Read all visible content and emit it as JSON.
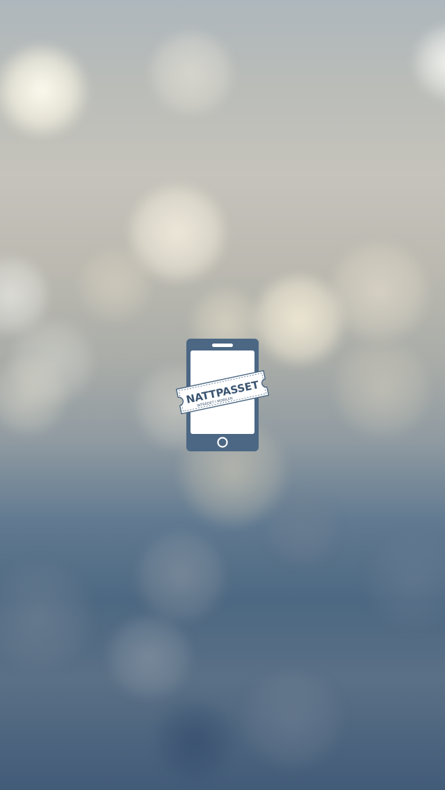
{
  "splash": {
    "logo": {
      "brand_name": "NATTPASSET",
      "tagline": "INTRÄDET I MOBILEN",
      "icon": "phone-ticket-icon",
      "colors": {
        "phone_body": "#4b6784",
        "screen": "#ffffff",
        "ticket": "#ffffff",
        "ticket_outline": "#4b6784",
        "text": "#3b5571"
      }
    },
    "background": {
      "style": "blurred-bokeh",
      "colors": {
        "top": "#aeb7bd",
        "middle": "#c5c3bb",
        "bottom": "#425b78",
        "highlight": "#f2ecdc"
      }
    }
  }
}
